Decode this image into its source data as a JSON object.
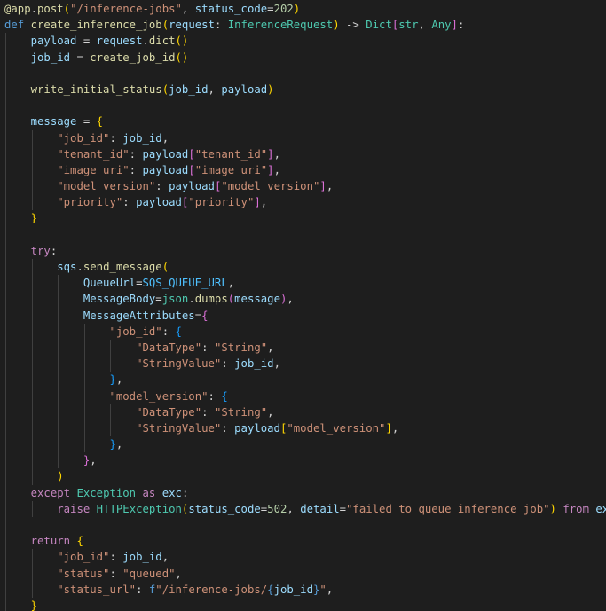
{
  "editor": {
    "language": "python",
    "theme_colors": {
      "background": "#1e1e1e",
      "default": "#d4d4d4",
      "keyword": "#569cd6",
      "control_keyword": "#c586c0",
      "function": "#dcdcaa",
      "variable": "#9cdcfe",
      "string": "#ce9178",
      "number": "#b5cea8",
      "type": "#4ec9b0",
      "constant": "#4fc1ff",
      "bracket_level_1": "#ffd700",
      "bracket_level_2": "#da70d6",
      "bracket_level_3": "#179fff",
      "indent_guide": "#404040"
    },
    "lines": [
      {
        "indent": 0,
        "tokens": [
          [
            "@app",
            "deco"
          ],
          [
            ".",
            "op"
          ],
          [
            "post",
            "deco"
          ],
          [
            "(",
            "b1"
          ],
          [
            "\"/inference-jobs\"",
            "str"
          ],
          [
            ", ",
            "pun"
          ],
          [
            "status_code",
            "var"
          ],
          [
            "=",
            "op"
          ],
          [
            "202",
            "num"
          ],
          [
            ")",
            "b1"
          ]
        ]
      },
      {
        "indent": 0,
        "tokens": [
          [
            "def",
            "kw"
          ],
          [
            " ",
            "pun"
          ],
          [
            "create_inference_job",
            "fn"
          ],
          [
            "(",
            "b1"
          ],
          [
            "request",
            "var"
          ],
          [
            ": ",
            "pun"
          ],
          [
            "InferenceRequest",
            "type"
          ],
          [
            ") ",
            "b1"
          ],
          [
            "-> ",
            "op"
          ],
          [
            "Dict",
            "type"
          ],
          [
            "[",
            "b2"
          ],
          [
            "str",
            "type"
          ],
          [
            ", ",
            "pun"
          ],
          [
            "Any",
            "type"
          ],
          [
            "]",
            "b2"
          ],
          [
            ":",
            "pun"
          ]
        ]
      },
      {
        "indent": 1,
        "tokens": [
          [
            "payload",
            "var"
          ],
          [
            " = ",
            "op"
          ],
          [
            "request",
            "var"
          ],
          [
            ".",
            "op"
          ],
          [
            "dict",
            "fn"
          ],
          [
            "()",
            "b1"
          ]
        ]
      },
      {
        "indent": 1,
        "tokens": [
          [
            "job_id",
            "var"
          ],
          [
            " = ",
            "op"
          ],
          [
            "create_job_id",
            "fn"
          ],
          [
            "()",
            "b1"
          ]
        ]
      },
      {
        "indent": 1,
        "tokens": []
      },
      {
        "indent": 1,
        "tokens": [
          [
            "write_initial_status",
            "fn"
          ],
          [
            "(",
            "b1"
          ],
          [
            "job_id",
            "var"
          ],
          [
            ", ",
            "pun"
          ],
          [
            "payload",
            "var"
          ],
          [
            ")",
            "b1"
          ]
        ]
      },
      {
        "indent": 1,
        "tokens": []
      },
      {
        "indent": 1,
        "tokens": [
          [
            "message",
            "var"
          ],
          [
            " = ",
            "op"
          ],
          [
            "{",
            "b1"
          ]
        ]
      },
      {
        "indent": 2,
        "tokens": [
          [
            "\"job_id\"",
            "str"
          ],
          [
            ": ",
            "pun"
          ],
          [
            "job_id",
            "var"
          ],
          [
            ",",
            "pun"
          ]
        ]
      },
      {
        "indent": 2,
        "tokens": [
          [
            "\"tenant_id\"",
            "str"
          ],
          [
            ": ",
            "pun"
          ],
          [
            "payload",
            "var"
          ],
          [
            "[",
            "b2"
          ],
          [
            "\"tenant_id\"",
            "str"
          ],
          [
            "]",
            "b2"
          ],
          [
            ",",
            "pun"
          ]
        ]
      },
      {
        "indent": 2,
        "tokens": [
          [
            "\"image_uri\"",
            "str"
          ],
          [
            ": ",
            "pun"
          ],
          [
            "payload",
            "var"
          ],
          [
            "[",
            "b2"
          ],
          [
            "\"image_uri\"",
            "str"
          ],
          [
            "]",
            "b2"
          ],
          [
            ",",
            "pun"
          ]
        ]
      },
      {
        "indent": 2,
        "tokens": [
          [
            "\"model_version\"",
            "str"
          ],
          [
            ": ",
            "pun"
          ],
          [
            "payload",
            "var"
          ],
          [
            "[",
            "b2"
          ],
          [
            "\"model_version\"",
            "str"
          ],
          [
            "]",
            "b2"
          ],
          [
            ",",
            "pun"
          ]
        ]
      },
      {
        "indent": 2,
        "tokens": [
          [
            "\"priority\"",
            "str"
          ],
          [
            ": ",
            "pun"
          ],
          [
            "payload",
            "var"
          ],
          [
            "[",
            "b2"
          ],
          [
            "\"priority\"",
            "str"
          ],
          [
            "]",
            "b2"
          ],
          [
            ",",
            "pun"
          ]
        ]
      },
      {
        "indent": 1,
        "tokens": [
          [
            "}",
            "b1"
          ]
        ]
      },
      {
        "indent": 1,
        "tokens": []
      },
      {
        "indent": 1,
        "tokens": [
          [
            "try",
            "ctrl"
          ],
          [
            ":",
            "pun"
          ]
        ]
      },
      {
        "indent": 2,
        "tokens": [
          [
            "sqs",
            "var"
          ],
          [
            ".",
            "op"
          ],
          [
            "send_message",
            "fn"
          ],
          [
            "(",
            "b1"
          ]
        ]
      },
      {
        "indent": 3,
        "tokens": [
          [
            "QueueUrl",
            "var"
          ],
          [
            "=",
            "op"
          ],
          [
            "SQS_QUEUE_URL",
            "const"
          ],
          [
            ",",
            "pun"
          ]
        ]
      },
      {
        "indent": 3,
        "tokens": [
          [
            "MessageBody",
            "var"
          ],
          [
            "=",
            "op"
          ],
          [
            "json",
            "type"
          ],
          [
            ".",
            "op"
          ],
          [
            "dumps",
            "fn"
          ],
          [
            "(",
            "b2"
          ],
          [
            "message",
            "var"
          ],
          [
            ")",
            "b2"
          ],
          [
            ",",
            "pun"
          ]
        ]
      },
      {
        "indent": 3,
        "tokens": [
          [
            "MessageAttributes",
            "var"
          ],
          [
            "=",
            "op"
          ],
          [
            "{",
            "b2"
          ]
        ]
      },
      {
        "indent": 4,
        "tokens": [
          [
            "\"job_id\"",
            "str"
          ],
          [
            ": ",
            "pun"
          ],
          [
            "{",
            "b3"
          ]
        ]
      },
      {
        "indent": 5,
        "tokens": [
          [
            "\"DataType\"",
            "str"
          ],
          [
            ": ",
            "pun"
          ],
          [
            "\"String\"",
            "str"
          ],
          [
            ",",
            "pun"
          ]
        ]
      },
      {
        "indent": 5,
        "tokens": [
          [
            "\"StringValue\"",
            "str"
          ],
          [
            ": ",
            "pun"
          ],
          [
            "job_id",
            "var"
          ],
          [
            ",",
            "pun"
          ]
        ]
      },
      {
        "indent": 4,
        "tokens": [
          [
            "}",
            "b3"
          ],
          [
            ",",
            "pun"
          ]
        ]
      },
      {
        "indent": 4,
        "tokens": [
          [
            "\"model_version\"",
            "str"
          ],
          [
            ": ",
            "pun"
          ],
          [
            "{",
            "b3"
          ]
        ]
      },
      {
        "indent": 5,
        "tokens": [
          [
            "\"DataType\"",
            "str"
          ],
          [
            ": ",
            "pun"
          ],
          [
            "\"String\"",
            "str"
          ],
          [
            ",",
            "pun"
          ]
        ]
      },
      {
        "indent": 5,
        "tokens": [
          [
            "\"StringValue\"",
            "str"
          ],
          [
            ": ",
            "pun"
          ],
          [
            "payload",
            "var"
          ],
          [
            "[",
            "b1"
          ],
          [
            "\"model_version\"",
            "str"
          ],
          [
            "]",
            "b1"
          ],
          [
            ",",
            "pun"
          ]
        ]
      },
      {
        "indent": 4,
        "tokens": [
          [
            "}",
            "b3"
          ],
          [
            ",",
            "pun"
          ]
        ]
      },
      {
        "indent": 3,
        "tokens": [
          [
            "}",
            "b2"
          ],
          [
            ",",
            "pun"
          ]
        ]
      },
      {
        "indent": 2,
        "tokens": [
          [
            ")",
            "b1"
          ]
        ]
      },
      {
        "indent": 1,
        "tokens": [
          [
            "except",
            "ctrl"
          ],
          [
            " ",
            "pun"
          ],
          [
            "Exception",
            "type"
          ],
          [
            " ",
            "pun"
          ],
          [
            "as",
            "ctrl"
          ],
          [
            " ",
            "pun"
          ],
          [
            "exc",
            "var"
          ],
          [
            ":",
            "pun"
          ]
        ]
      },
      {
        "indent": 2,
        "tokens": [
          [
            "raise",
            "ctrl"
          ],
          [
            " ",
            "pun"
          ],
          [
            "HTTPException",
            "type"
          ],
          [
            "(",
            "b1"
          ],
          [
            "status_code",
            "var"
          ],
          [
            "=",
            "op"
          ],
          [
            "502",
            "num"
          ],
          [
            ", ",
            "pun"
          ],
          [
            "detail",
            "var"
          ],
          [
            "=",
            "op"
          ],
          [
            "\"failed to queue inference job\"",
            "str"
          ],
          [
            ")",
            "b1"
          ],
          [
            " ",
            "pun"
          ],
          [
            "from",
            "ctrl"
          ],
          [
            " ",
            "pun"
          ],
          [
            "exc",
            "var"
          ]
        ]
      },
      {
        "indent": 1,
        "tokens": []
      },
      {
        "indent": 1,
        "tokens": [
          [
            "return",
            "ctrl"
          ],
          [
            " ",
            "pun"
          ],
          [
            "{",
            "b1"
          ]
        ]
      },
      {
        "indent": 2,
        "tokens": [
          [
            "\"job_id\"",
            "str"
          ],
          [
            ": ",
            "pun"
          ],
          [
            "job_id",
            "var"
          ],
          [
            ",",
            "pun"
          ]
        ]
      },
      {
        "indent": 2,
        "tokens": [
          [
            "\"status\"",
            "str"
          ],
          [
            ": ",
            "pun"
          ],
          [
            "\"queued\"",
            "str"
          ],
          [
            ",",
            "pun"
          ]
        ]
      },
      {
        "indent": 2,
        "tokens": [
          [
            "\"status_url\"",
            "str"
          ],
          [
            ": ",
            "pun"
          ],
          [
            "f",
            "kw"
          ],
          [
            "\"/inference-jobs/",
            "str"
          ],
          [
            "{",
            "kw"
          ],
          [
            "job_id",
            "var"
          ],
          [
            "}",
            "kw"
          ],
          [
            "\"",
            "str"
          ],
          [
            ",",
            "pun"
          ]
        ]
      },
      {
        "indent": 1,
        "tokens": [
          [
            "}",
            "b1"
          ]
        ]
      }
    ]
  }
}
